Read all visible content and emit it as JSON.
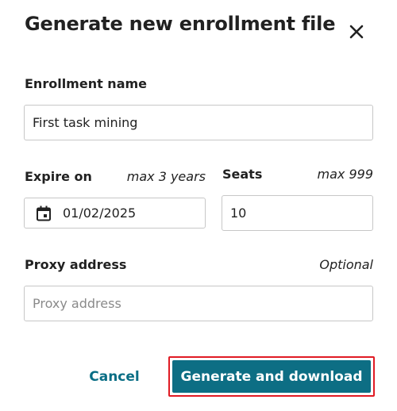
{
  "dialog": {
    "title": "Generate new enrollment file",
    "close_icon": "close-icon"
  },
  "enrollment_name": {
    "label": "Enrollment name",
    "value": "First task mining"
  },
  "expire_on": {
    "label": "Expire on",
    "hint": "max 3 years",
    "value": "01/02/2025",
    "icon": "calendar-icon"
  },
  "seats": {
    "label": "Seats",
    "hint": "max 999",
    "value": "10"
  },
  "proxy": {
    "label": "Proxy address",
    "hint": "Optional",
    "placeholder": "Proxy address",
    "value": ""
  },
  "actions": {
    "cancel_label": "Cancel",
    "primary_label": "Generate and download"
  },
  "colors": {
    "accent": "#0d6e84",
    "highlight_border": "#e01b24",
    "text": "#212121",
    "border": "#c7c7c7"
  }
}
